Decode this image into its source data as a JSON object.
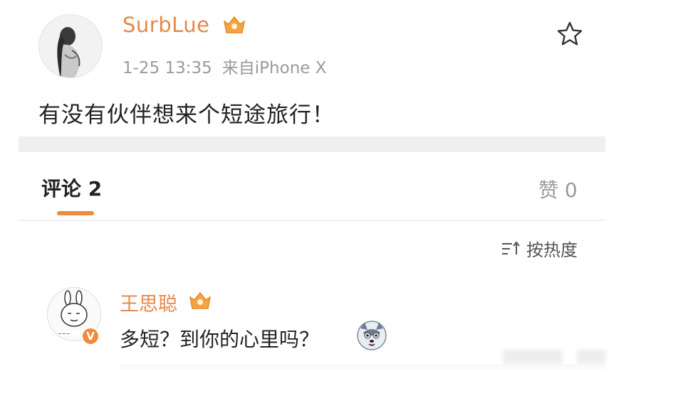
{
  "post": {
    "username": "SurbLue",
    "time": "1-25 13:35",
    "source": "来自iPhone X",
    "text": "有没有伙伴想来个短途旅行！"
  },
  "tabs": {
    "comments_label": "评论 2",
    "likes_label": "赞 0"
  },
  "sort": {
    "label": "按热度"
  },
  "comment": {
    "username": "王思聪",
    "text": "多短？到你的心里吗？"
  },
  "icons": {
    "star": "star-outline-icon",
    "vip": "crown-vip-icon",
    "sort": "sort-icon",
    "verified": "verified-icon",
    "emoji": "husky-emoji-icon"
  },
  "colors": {
    "accent": "#f08a3c",
    "username": "#e8884a",
    "muted": "#9a9a9a",
    "divider": "#efefef"
  }
}
